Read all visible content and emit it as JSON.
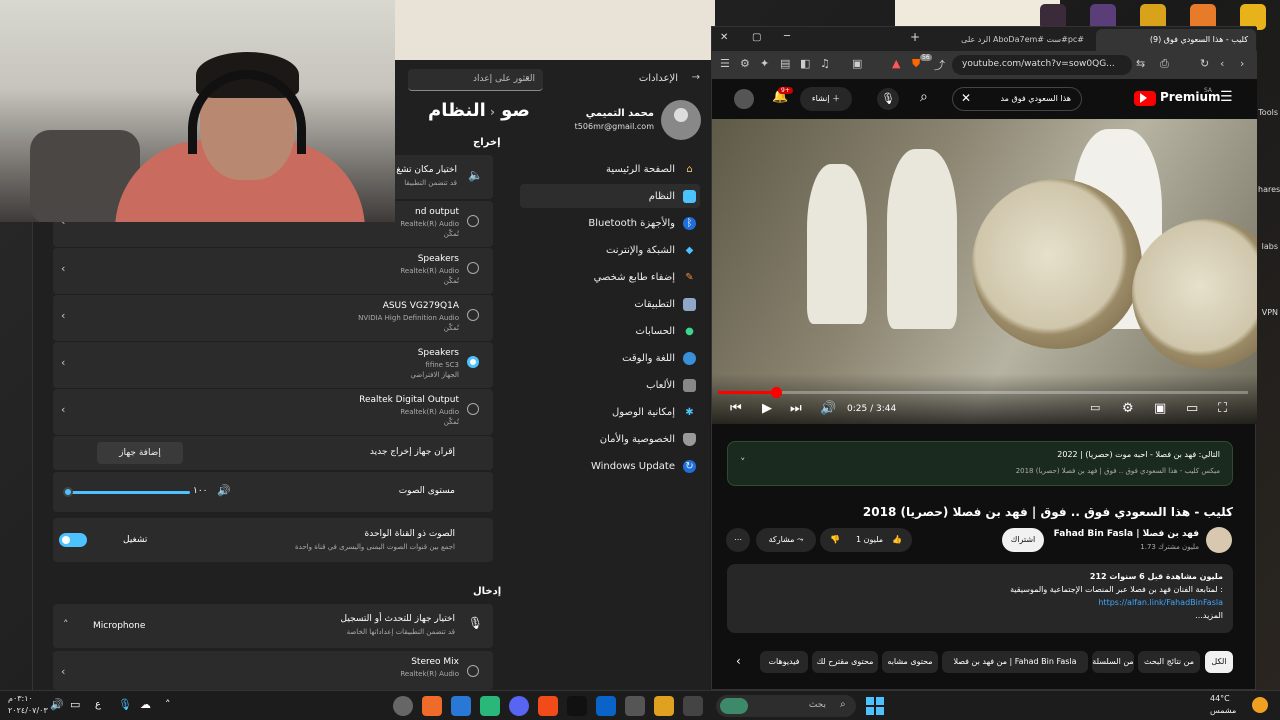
{
  "colors": {
    "accent": "#4cc2ff",
    "yt_red": "#ff0000",
    "settings_bg": "#202020",
    "card_bg": "#2b2b2b"
  },
  "desktop": {
    "side_labels": [
      "Tools",
      "hares",
      "labs",
      "VPN"
    ]
  },
  "settings": {
    "app_title": "الإعدادات",
    "search_placeholder": "العثور على إعداد",
    "breadcrumb": "النظام",
    "breadcrumb_cut": "صو",
    "profile": {
      "name": "محمد التميمي",
      "email": "t506mr@gmail.com"
    },
    "nav": [
      {
        "label": "الصفحة الرئيسية",
        "icon": "home-icon"
      },
      {
        "label": "النظام",
        "icon": "system-icon"
      },
      {
        "label": "Bluetooth والأجهزة",
        "icon": "bluetooth-icon"
      },
      {
        "label": "الشبكة والإنترنت",
        "icon": "wifi-icon"
      },
      {
        "label": "إضفاء طابع شخصي",
        "icon": "brush-icon"
      },
      {
        "label": "التطبيقات",
        "icon": "apps-icon"
      },
      {
        "label": "الحسابات",
        "icon": "person-icon"
      },
      {
        "label": "اللغة والوقت",
        "icon": "globe-icon"
      },
      {
        "label": "الألعاب",
        "icon": "gamepad-icon"
      },
      {
        "label": "إمكانية الوصول",
        "icon": "accessibility-icon"
      },
      {
        "label": "الخصوصية والأمان",
        "icon": "shield-icon"
      },
      {
        "label": "Windows Update",
        "icon": "update-icon"
      }
    ],
    "output_header": "إخراج",
    "output_choose_title": "اختيار مكان تشغ",
    "output_choose_sub": "قد تتضمن التطبيقا",
    "devices": [
      {
        "name": "nd output",
        "sub1": "Realtek(R) Audio",
        "sub2": "تُمكّن",
        "selected": false
      },
      {
        "name": "Speakers",
        "sub1": "Realtek(R) Audio",
        "sub2": "تُمكّن",
        "selected": false
      },
      {
        "name": "ASUS VG279Q1A",
        "sub1": "NVIDIA High Definition Audio",
        "sub2": "تُمكّن",
        "selected": false
      },
      {
        "name": "Speakers",
        "sub1": "fifine SC3",
        "sub2": "الجهاز الافتراضي",
        "selected": true
      },
      {
        "name": "Realtek Digital Output",
        "sub1": "Realtek(R) Audio",
        "sub2": "تُمكّن",
        "selected": false
      }
    ],
    "pair_label": "إقران جهاز إخراج جديد",
    "add_device": "إضافة جهاز",
    "volume_label": "مستوى الصوت",
    "volume_value": "١٠٠",
    "volume_fraction": 1.0,
    "mono_title": "الصوت ذو القناة الواحدة",
    "mono_sub": "اجمع بين قنوات الصوت اليمنى واليسرى في قناة واحدة",
    "mono_state": "تشغيل",
    "input_header": "إدخال",
    "input_choose_title": "اختيار جهاز للتحدث أو التسجيل",
    "input_choose_sub": "قد تتضمن التطبيقات إعداداتها الخاصة",
    "input_selected": "Microphone",
    "input_device": {
      "name": "Stereo Mix",
      "sub1": "Realtek(R) Audio"
    }
  },
  "browser": {
    "tabs": [
      {
        "label": "(9) كليب - هذا السعودي فوق",
        "active": true
      },
      {
        "label": "الرد على AboDa7em# ست#pc#",
        "active": false
      }
    ],
    "url": "youtube.com/watch?v=sow0QG...",
    "shield_count": "56",
    "youtube": {
      "brand": "Premium",
      "region": "SA",
      "search_value": "هذا السعودي فوق مد",
      "create_label": "إنشاء",
      "notif_count": "9+",
      "time": "0:25 / 3:44",
      "progress_fraction": 0.11,
      "next": {
        "title": "التالي: فهد بن فصلا - احبه موت (حصريا) | 2022",
        "sub": "ميكس كليب - هذا السعودي فوق .. فوق | فهد بن فصلا (حصريا) 2018"
      },
      "title": "كليب - هذا السعودي فوق .. فوق | فهد بن فصلا (حصريا) 2018",
      "channel": "Fahad Bin Fasla | فهد بن فصلا",
      "subs": "1.73 مليون مشترك",
      "subscribe": "اشتراك",
      "likes": "1 مليون",
      "share": "مشاركة",
      "views_line": "212 مليون مشاهدة  قبل 6 سنوات",
      "desc_line": "لمتابعة الفنان فهد بن فصلا عبر المنصات الإجتماعية والموسيقية :",
      "desc_link": "https://alfan.link/FahadBinFasla",
      "more": "...المزيد",
      "chips": [
        "الكل",
        "من نتائج البحث",
        "من السلسلة",
        "من فهد بن فصلا | Fahad Bin Fasla",
        "محتوى مشابه",
        "محتوى مقترح لك",
        "فيديوهات"
      ]
    }
  },
  "taskbar": {
    "search_placeholder": "بحث",
    "weather_temp": "44°C",
    "weather_desc": "مشمس",
    "time": "٠٣:١٠م",
    "date": "٢٠٢٤/٠٧/٠٣",
    "lang": "ع"
  }
}
